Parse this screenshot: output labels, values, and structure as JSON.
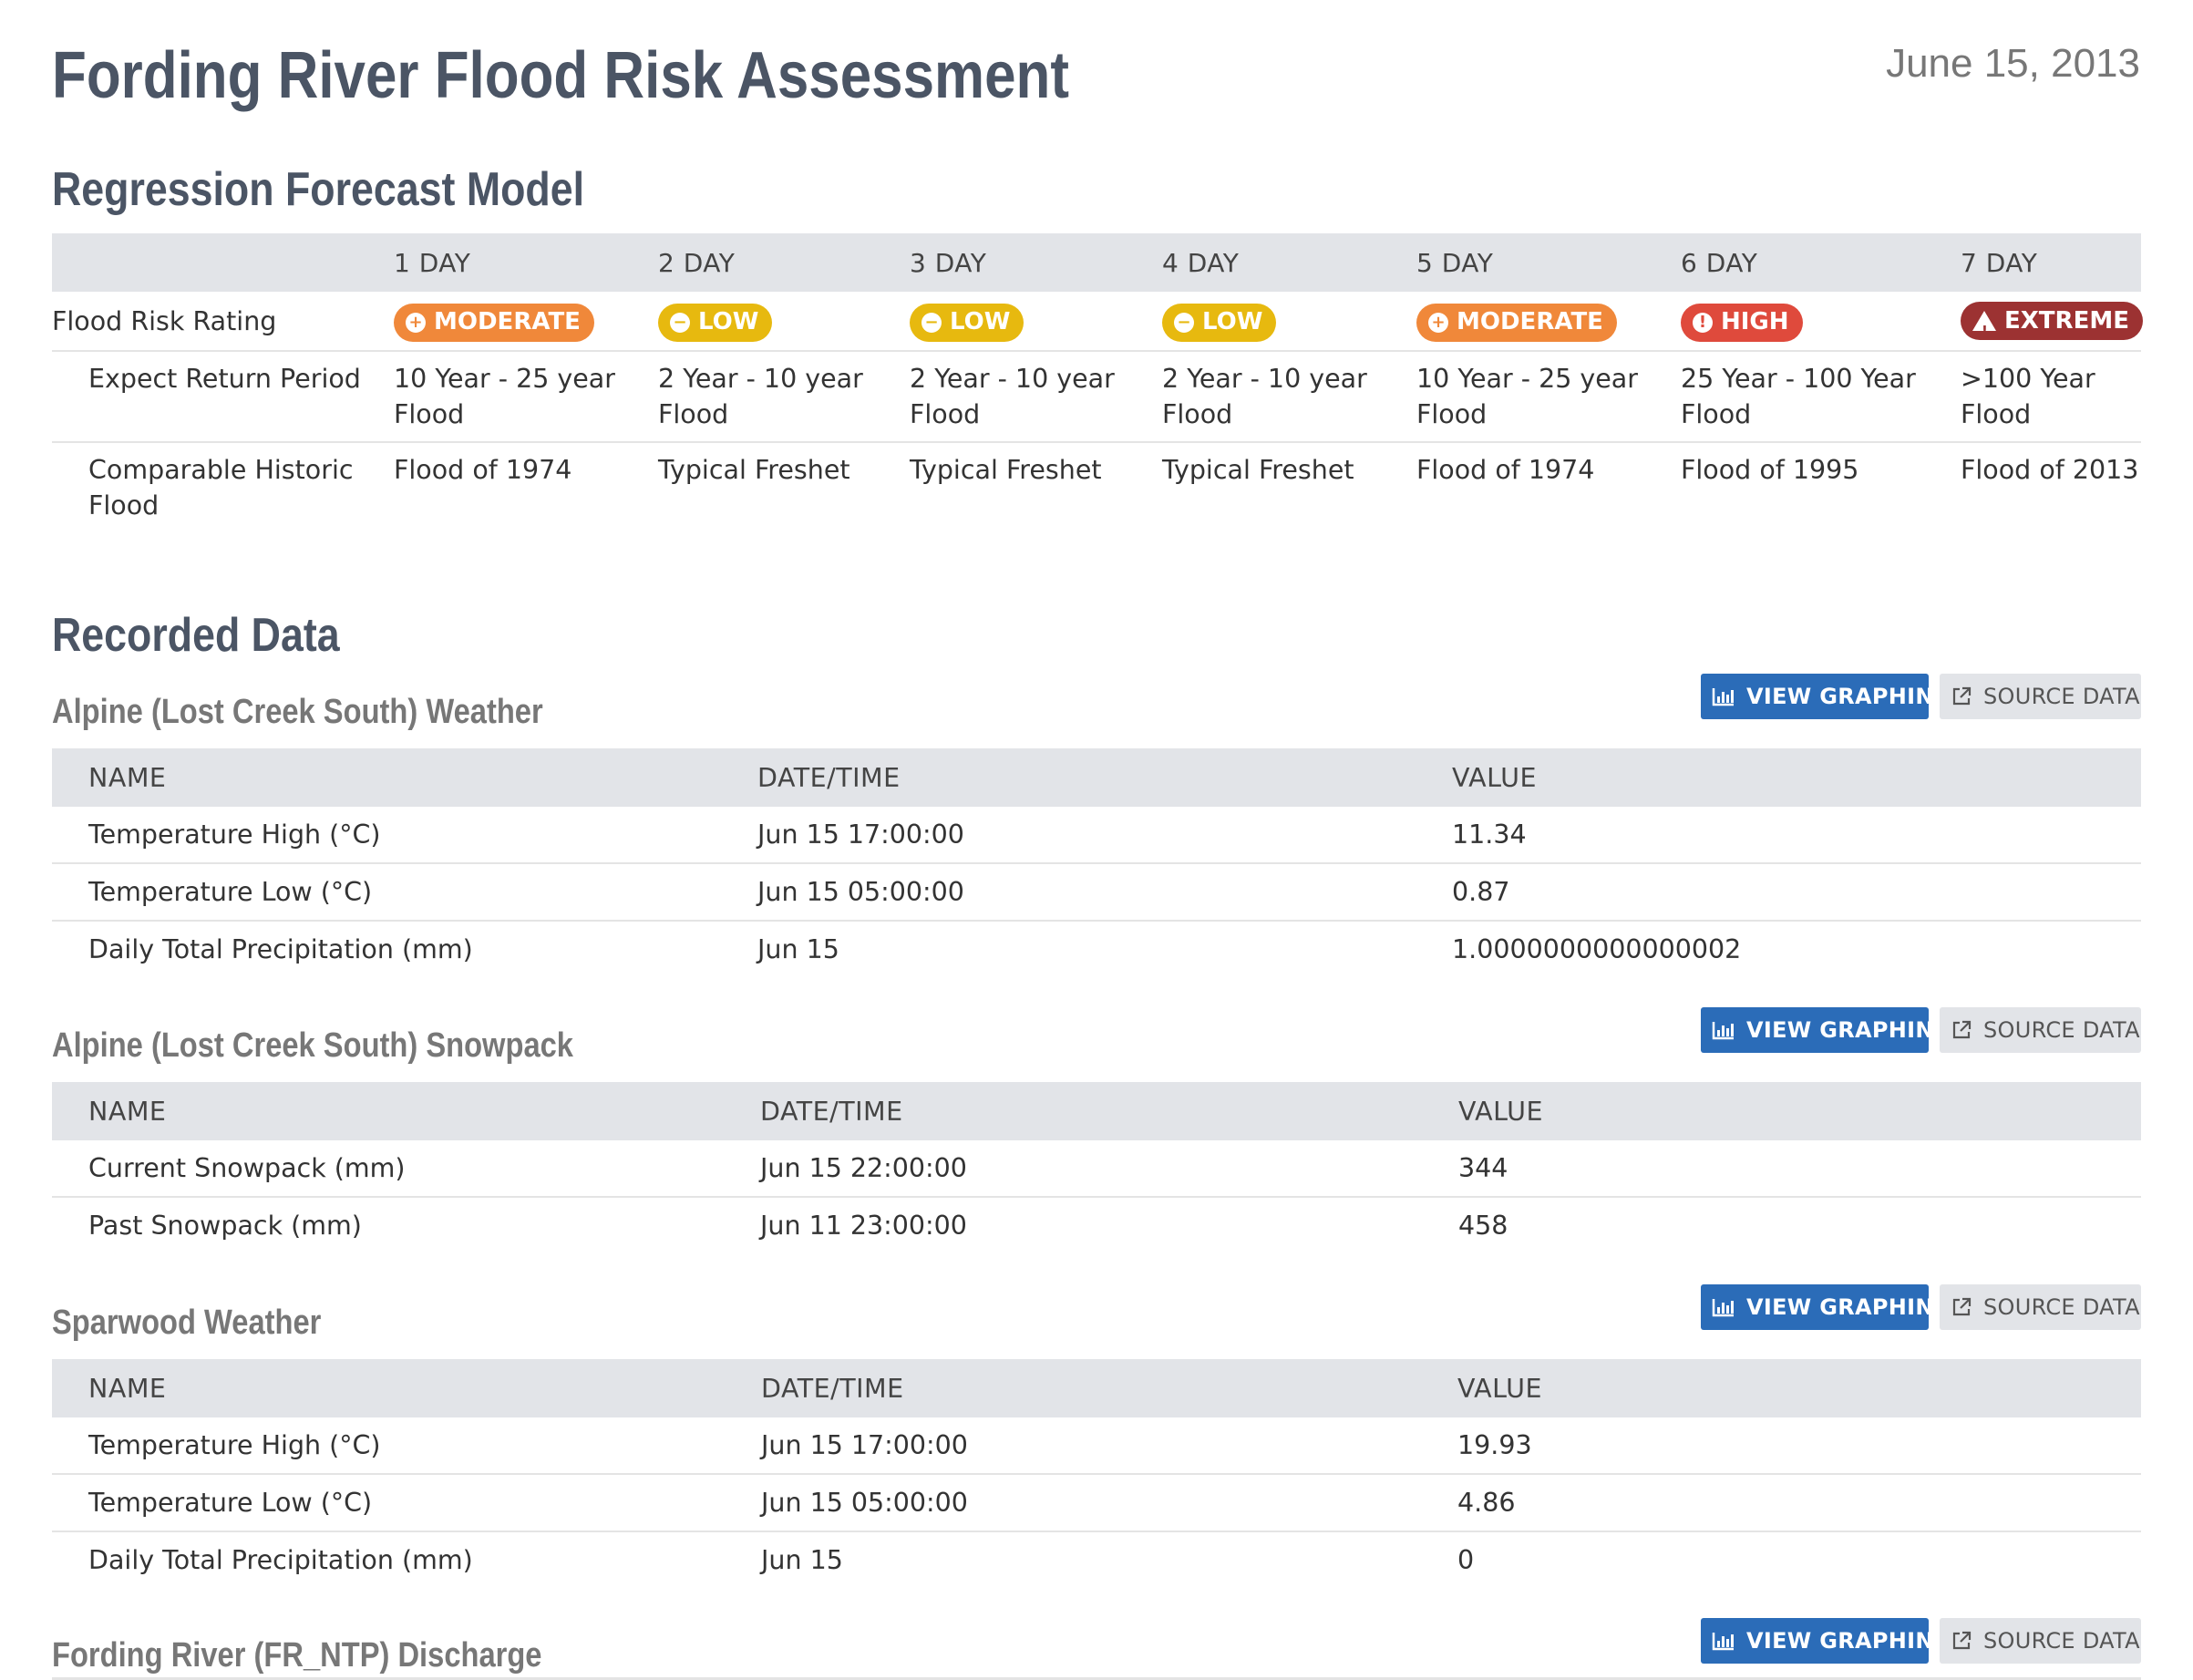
{
  "header": {
    "title": "Fording River Flood Risk Assessment",
    "date": "June 15, 2013"
  },
  "forecast": {
    "heading": "Regression Forecast Model",
    "columns": [
      "",
      "1 DAY",
      "2 DAY",
      "3 DAY",
      "4 DAY",
      "5 DAY",
      "6 DAY",
      "7 DAY"
    ],
    "rows": [
      {
        "label": "Flood Risk Rating",
        "badges": [
          {
            "text": "MODERATE",
            "level": "moderate",
            "color": "#f0883a",
            "icon": "plus-circle-icon"
          },
          {
            "text": "LOW",
            "level": "low",
            "color": "#e7b90f",
            "icon": "minus-circle-icon"
          },
          {
            "text": "LOW",
            "level": "low",
            "color": "#e7b90f",
            "icon": "minus-circle-icon"
          },
          {
            "text": "LOW",
            "level": "low",
            "color": "#e7b90f",
            "icon": "minus-circle-icon"
          },
          {
            "text": "MODERATE",
            "level": "moderate",
            "color": "#f0883a",
            "icon": "plus-circle-icon"
          },
          {
            "text": "HIGH",
            "level": "high",
            "color": "#df4a3c",
            "icon": "exclamation-circle-icon"
          },
          {
            "text": "EXTREME",
            "level": "extreme",
            "color": "#9c3232",
            "icon": "warning-triangle-icon"
          }
        ]
      },
      {
        "label": "Expect Return Period",
        "values": [
          "10 Year - 25 year Flood",
          "2 Year - 10 year Flood",
          "2 Year - 10 year Flood",
          "2 Year - 10 year Flood",
          "10 Year - 25 year Flood",
          "25 Year - 100 Year Flood",
          ">100 Year Flood"
        ]
      },
      {
        "label": "Comparable Historic Flood",
        "values": [
          "Flood of 1974",
          "Typical Freshet",
          "Typical Freshet",
          "Typical Freshet",
          "Flood of 1974",
          "Flood of 1995",
          "Flood of 2013"
        ]
      }
    ]
  },
  "recorded": {
    "heading": "Recorded Data",
    "buttons": {
      "graph": "VIEW GRAPHING",
      "source": "SOURCE DATA"
    },
    "columns": {
      "name": "NAME",
      "datetime": "DATE/TIME",
      "value": "VALUE"
    },
    "sections": [
      {
        "title": "Alpine (Lost Creek South) Weather",
        "rows": [
          {
            "name": "Temperature High (°C)",
            "datetime": "Jun 15 17:00:00",
            "value": "11.34"
          },
          {
            "name": "Temperature Low (°C)",
            "datetime": "Jun 15 05:00:00",
            "value": "0.87"
          },
          {
            "name": "Daily Total Precipitation (mm)",
            "datetime": "Jun 15",
            "value": "1.0000000000000002"
          }
        ]
      },
      {
        "title": "Alpine (Lost Creek South) Snowpack",
        "rows": [
          {
            "name": "Current Snowpack (mm)",
            "datetime": "Jun 15 22:00:00",
            "value": "344"
          },
          {
            "name": "Past Snowpack (mm)",
            "datetime": "Jun 11 23:00:00",
            "value": "458"
          }
        ]
      },
      {
        "title": "Sparwood Weather",
        "rows": [
          {
            "name": "Temperature High (°C)",
            "datetime": "Jun 15 17:00:00",
            "value": "19.93"
          },
          {
            "name": "Temperature Low (°C)",
            "datetime": "Jun 15 05:00:00",
            "value": "4.86"
          },
          {
            "name": "Daily Total Precipitation (mm)",
            "datetime": "Jun 15",
            "value": "0"
          }
        ]
      },
      {
        "title": "Fording River (FR_NTP) Discharge",
        "rows": []
      }
    ]
  },
  "colors": {
    "heading": "#4b5565",
    "subheading": "#777777",
    "table_header_bg": "#e2e4e8",
    "primary_button": "#2b6cb8"
  }
}
